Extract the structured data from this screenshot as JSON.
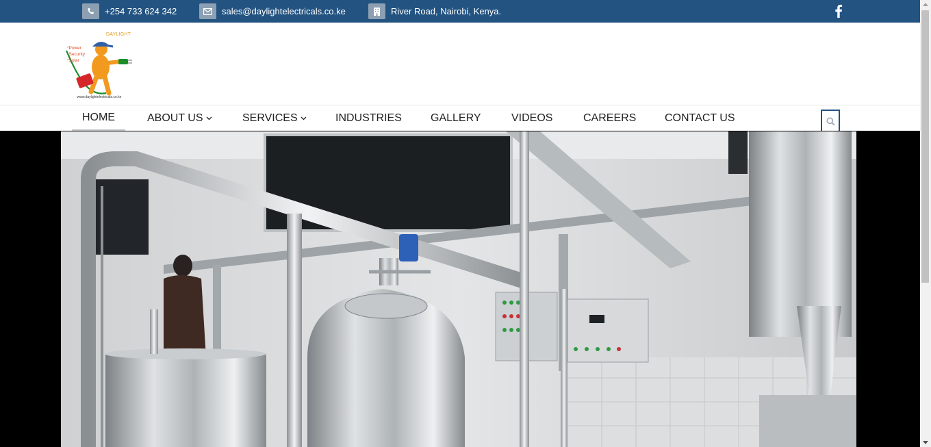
{
  "topbar": {
    "phone": "+254 733 624 342",
    "email": "sales@daylightelectricals.co.ke",
    "address": "River Road, Nairobi, Kenya.",
    "icons": [
      "phone-icon",
      "envelope-icon",
      "building-icon",
      "facebook-icon"
    ]
  },
  "logo": {
    "brand": "DAYLIGHT",
    "taglines": [
      "*Power",
      "*Security",
      "*Solar"
    ],
    "url": "www.daylightelectricals.co.ke"
  },
  "nav": {
    "items": [
      {
        "label": "HOME",
        "active": true
      },
      {
        "label": "ABOUT US",
        "dropdown": true
      },
      {
        "label": "SERVICES",
        "dropdown": true
      },
      {
        "label": "INDUSTRIES"
      },
      {
        "label": "GALLERY"
      },
      {
        "label": "VIDEOS"
      },
      {
        "label": "CAREERS"
      },
      {
        "label": "CONTACT US"
      }
    ]
  },
  "colors": {
    "topbar_bg": "#235381",
    "icon_box": "#8d9fb2",
    "nav_text": "#222222",
    "active_underline": "#c9c9c9"
  }
}
